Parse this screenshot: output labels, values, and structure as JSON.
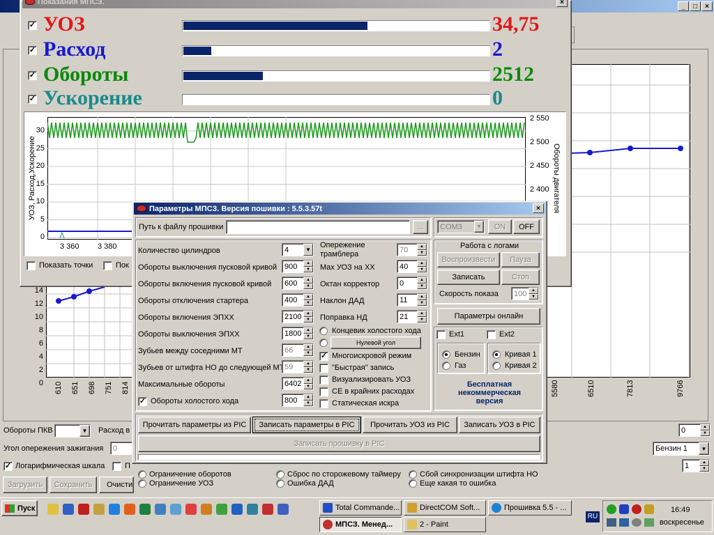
{
  "background": {
    "bottom_labels": {
      "pkv": "Обороты ПКВ",
      "rashod": "Расход в",
      "ugol": "Угол опережения зажигания",
      "ugol_val": "0",
      "log_scale": "Логарифмическая шкала",
      "pe": "П"
    },
    "buttons": {
      "load": "Загрузить",
      "save": "Сохранить",
      "clear": "Очисти"
    },
    "right_controls": {
      "spin_val": "0",
      "fuel_select": "Бензин 1",
      "spin2_val": "1"
    },
    "chart_x_left": [
      "610",
      "651",
      "698",
      "751",
      "814"
    ],
    "chart_y_left": [
      "14",
      "12",
      "10",
      "8",
      "6",
      "4",
      "2",
      "0"
    ],
    "chart_x_right": [
      "5580",
      "6510",
      "7813",
      "9766"
    ]
  },
  "window_mpsz": {
    "title": "Показания МПСЗ.",
    "rows": [
      {
        "label": "УОЗ",
        "value": "34,75",
        "color": "#e01818",
        "fill": 0.6
      },
      {
        "label": "Расход",
        "value": "2",
        "color": "#1818d0",
        "fill": 0.09
      },
      {
        "label": "Обороты",
        "value": "2512",
        "color": "#0a8a0a",
        "fill": 0.26
      },
      {
        "label": "Ускорение",
        "value": "0",
        "color": "#1a8a8a",
        "fill": 0
      }
    ],
    "chart": {
      "left_axis_label": "УОЗ, Расход,Ускорение",
      "right_axis_label": "Обороты двигателя",
      "y_left_ticks": [
        "30",
        "25",
        "20",
        "15",
        "10",
        "5",
        "0"
      ],
      "y_right_ticks": [
        "2 550",
        "2 500",
        "2 450",
        "2 400"
      ],
      "x_ticks": [
        "3 360",
        "3 380"
      ]
    },
    "show_points": "Показать точки",
    "show_other": "Пок"
  },
  "window_params": {
    "title": "Параметры МПСЗ. Версия пошивки : 5.5.3.57t",
    "firmware_path_label": "Путь к файлу прошивки",
    "firmware_path_value": "",
    "browse": "...",
    "com_port": "COM3",
    "on": "ON",
    "off": "OFF",
    "left_params": [
      {
        "label": "Количество цилиндров",
        "value": "4",
        "type": "combo"
      },
      {
        "label": "Обороты выключения пусковой кривой",
        "value": "900"
      },
      {
        "label": "Обороты включения пусковой кривой",
        "value": "600"
      },
      {
        "label": "Обороты отключения стартера",
        "value": "400"
      },
      {
        "label": "Обороты включения ЭПХХ",
        "value": "2100"
      },
      {
        "label": "Обороты выключения ЭПХХ",
        "value": "1800"
      },
      {
        "label": "Зубьев между соседними МТ",
        "value": "66",
        "disabled": true
      },
      {
        "label": "Зубьев от штифта НО до следующей МТ",
        "value": "59",
        "disabled": true
      },
      {
        "label": "Максимальные обороты",
        "value": "6402"
      },
      {
        "label": "Обороты холостого хода",
        "value": "800",
        "checkbox": true
      }
    ],
    "mid_params": [
      {
        "label": "Опережение трамблера",
        "value": "70",
        "disabled": true
      },
      {
        "label": "Max УОЗ на ХХ",
        "value": "40"
      },
      {
        "label": "Октан корректор",
        "value": "0"
      },
      {
        "label": "Наклон ДАД",
        "value": "11"
      },
      {
        "label": "Поправка НД",
        "value": "21"
      }
    ],
    "mid_options": {
      "idle_switch": "Концевик холостого хода",
      "zero_angle": "Нулевой угол",
      "multispark": "Многоискровой режим",
      "fast_write": "\"Быстрая\" запись",
      "visualize": "Визуализировать УОЗ",
      "ce_extreme": "СЕ в крайних расходах",
      "static_spark": "Статическая искра"
    },
    "logs": {
      "title": "Работа с логами",
      "play": "Воспроизвести",
      "pause": "Пауза",
      "record": "Записать",
      "stop": "Стоп",
      "speed_label": "Скорость показа",
      "speed_value": "100"
    },
    "online_params": "Параметры  онлайн",
    "ext1": "Ext1",
    "ext2": "Ext2",
    "fuel": {
      "petrol": "Бензин",
      "gas": "Газ"
    },
    "curve": {
      "c1": "Кривая 1",
      "c2": "Кривая 2"
    },
    "free_notice": "Бесплатная некоммерческая версия",
    "actions": {
      "read_params": "Прочитать параметры из PIC",
      "write_params": "Записать параметры в PIC",
      "read_uoz": "Прочитать УОЗ из PIC",
      "write_uoz": "Записать УОЗ в PIC",
      "write_fw": "Записать прошивку в PIC"
    },
    "status": {
      "rpm_limit": "Ограничение оборотов",
      "uoz_limit": "Ограничение УОЗ",
      "watchdog": "Сброс по сторожевому таймеру",
      "dad_error": "Ошибка ДАД",
      "sync_fail": "Сбой синхронизации штифта НО",
      "other_error": "Еще какая то ошибка"
    }
  },
  "taskbar": {
    "start": "Пуск",
    "tasks_top": [
      "Total Commande...",
      "DirectCOM Soft...",
      "Прошивка 5.5 - ..."
    ],
    "tasks_bottom": [
      "МПСЗ. Менед...",
      "2 - Paint"
    ],
    "lang": "RU",
    "time": "16:49",
    "day": "воскресенье"
  },
  "colors": {
    "titlebar_active": "#0a246a",
    "free_notice": "#0a246a",
    "green_signal": "#1a9a1a"
  }
}
